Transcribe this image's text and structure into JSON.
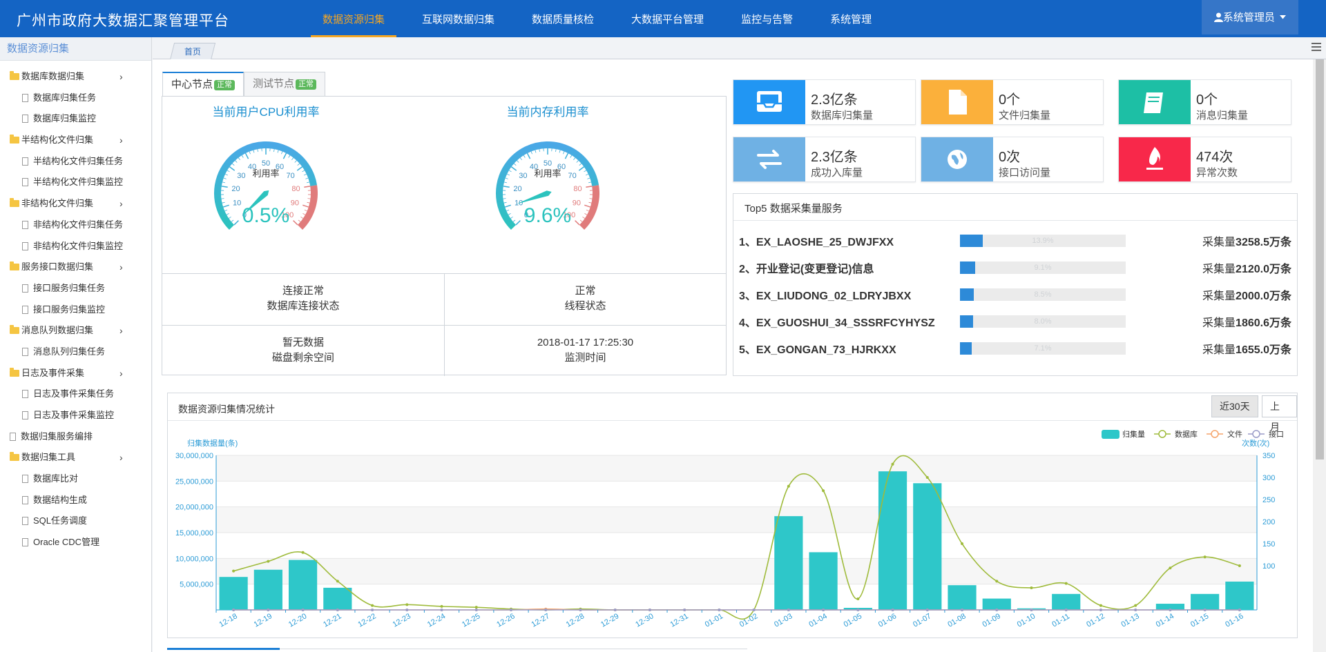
{
  "app": {
    "title": "广州市政府大数据汇聚管理平台",
    "user": "系统管理员"
  },
  "nav": [
    {
      "label": "数据资源归集",
      "active": true
    },
    {
      "label": "互联网数据归集"
    },
    {
      "label": "数据质量核检"
    },
    {
      "label": "大数据平台管理"
    },
    {
      "label": "监控与告警"
    },
    {
      "label": "系统管理"
    }
  ],
  "sidebar": {
    "title": "数据资源归集",
    "items": [
      {
        "label": "数据库数据归集",
        "group": true
      },
      {
        "label": "数据库归集任务"
      },
      {
        "label": "数据库归集监控"
      },
      {
        "label": "半结构化文件归集",
        "group": true
      },
      {
        "label": "半结构化文件归集任务"
      },
      {
        "label": "半结构化文件归集监控"
      },
      {
        "label": "非结构化文件归集",
        "group": true
      },
      {
        "label": "非结构化文件归集任务"
      },
      {
        "label": "非结构化文件归集监控"
      },
      {
        "label": "服务接口数据归集",
        "group": true
      },
      {
        "label": "接口服务归集任务"
      },
      {
        "label": "接口服务归集监控"
      },
      {
        "label": "消息队列数据归集",
        "group": true
      },
      {
        "label": "消息队列归集任务"
      },
      {
        "label": "日志及事件采集",
        "group": true
      },
      {
        "label": "日志及事件采集任务"
      },
      {
        "label": "日志及事件采集监控"
      },
      {
        "label": "数据归集服务编排",
        "doc_root": true
      },
      {
        "label": "数据归集工具",
        "group": true
      },
      {
        "label": "数据库比对"
      },
      {
        "label": "数据结构生成"
      },
      {
        "label": "SQL任务调度"
      },
      {
        "label": "Oracle CDC管理"
      }
    ]
  },
  "page_tab": "首页",
  "node_tabs": [
    {
      "label": "中心节点",
      "badge": "正常",
      "active": true
    },
    {
      "label": "测试节点",
      "badge": "正常"
    }
  ],
  "gauges": [
    {
      "title": "当前用户CPU利用率",
      "label": "利用率",
      "value": 0.5,
      "value_text": "0.5%",
      "ticks": [
        "0",
        "10",
        "20",
        "30",
        "40",
        "50",
        "60",
        "70",
        "80",
        "90",
        "100"
      ]
    },
    {
      "title": "当前内存利用率",
      "label": "利用率",
      "value": 9.6,
      "value_text": "9.6%",
      "ticks": [
        "0",
        "10",
        "20",
        "30",
        "40",
        "50",
        "60",
        "70",
        "80",
        "90",
        "100"
      ]
    }
  ],
  "status": [
    {
      "value": "连接正常",
      "label": "数据库连接状态"
    },
    {
      "value": "正常",
      "label": "线程状态"
    },
    {
      "value": "暂无数据",
      "label": "磁盘剩余空间"
    },
    {
      "value": "2018-01-17 17:25:30",
      "label": "监测时间"
    }
  ],
  "cards": [
    {
      "value": "2.3亿条",
      "label": "数据库归集量",
      "color": "#2196f3",
      "icon": "inbox-icon"
    },
    {
      "value": "0个",
      "label": "文件归集量",
      "color": "#fbb03b",
      "icon": "file-icon"
    },
    {
      "value": "0个",
      "label": "消息归集量",
      "color": "#1dbfa5",
      "icon": "book-icon"
    },
    {
      "value": "2.3亿条",
      "label": "成功入库量",
      "color": "#6fb1e4",
      "icon": "exchange-icon"
    },
    {
      "value": "0次",
      "label": "接口访问量",
      "color": "#6fb1e4",
      "icon": "globe-icon"
    },
    {
      "value": "474次",
      "label": "异常次数",
      "color": "#f8284a",
      "icon": "fire-icon"
    }
  ],
  "top5": {
    "title": "Top5 数据采集量服务",
    "amount_prefix": "采集量",
    "rows": [
      {
        "name": "1、EX_LAOSHE_25_DWJFXX",
        "pct": 13.9,
        "pct_text": "13.9%",
        "amount": "3258.5万条"
      },
      {
        "name": "2、开业登记(变更登记)信息",
        "pct": 9.1,
        "pct_text": "9.1%",
        "amount": "2120.0万条"
      },
      {
        "name": "3、EX_LIUDONG_02_LDRYJBXX",
        "pct": 8.5,
        "pct_text": "8.5%",
        "amount": "2000.0万条"
      },
      {
        "name": "4、EX_GUOSHUI_34_SSSRFCYHYSZ",
        "pct": 8.0,
        "pct_text": "8.0%",
        "amount": "1860.6万条"
      },
      {
        "name": "5、EX_GONGAN_73_HJRKXX",
        "pct": 7.1,
        "pct_text": "7.1%",
        "amount": "1655.0万条"
      }
    ]
  },
  "stats_panel": {
    "title": "数据资源归集情况统计",
    "buttons": [
      {
        "label": "近30天",
        "active": true
      },
      {
        "label": "上月"
      }
    ]
  },
  "chart_data": {
    "type": "bar",
    "categories": [
      "12-18",
      "12-19",
      "12-20",
      "12-21",
      "12-22",
      "12-23",
      "12-24",
      "12-25",
      "12-26",
      "12-27",
      "12-28",
      "12-29",
      "12-30",
      "12-31",
      "01-01",
      "01-02",
      "01-03",
      "01-04",
      "01-05",
      "01-06",
      "01-07",
      "01-08",
      "01-09",
      "01-10",
      "01-11",
      "01-12",
      "01-13",
      "01-14",
      "01-15",
      "01-16"
    ],
    "series": [
      {
        "name": "归集量",
        "type": "bar",
        "axis": "left",
        "color": "#2ec7c9",
        "values": [
          6400000,
          7800000,
          9700000,
          4300000,
          0,
          0,
          0,
          0,
          0,
          0,
          0,
          0,
          0,
          0,
          0,
          0,
          18200000,
          11200000,
          400000,
          26900000,
          24600000,
          4800000,
          2200000,
          300000,
          3100000,
          0,
          0,
          1200000,
          3100000,
          5500000
        ]
      },
      {
        "name": "数据库",
        "type": "line",
        "axis": "right",
        "color": "#9fbb3b",
        "values": [
          88,
          110,
          130,
          65,
          10,
          12,
          8,
          6,
          2,
          0,
          2,
          0,
          0,
          0,
          0,
          0,
          280,
          270,
          25,
          330,
          300,
          150,
          65,
          50,
          60,
          10,
          10,
          95,
          120,
          100
        ]
      },
      {
        "name": "文件",
        "type": "line",
        "axis": "right",
        "color": "#f5a46a",
        "values": [
          0,
          0,
          0,
          0,
          0,
          0,
          0,
          0,
          0,
          2,
          0,
          0,
          0,
          0,
          0,
          0,
          0,
          0,
          0,
          0,
          0,
          0,
          0,
          0,
          0,
          0,
          0,
          0,
          0,
          0
        ]
      },
      {
        "name": "接口",
        "type": "line",
        "axis": "right",
        "color": "#9a9cc8",
        "values": [
          0,
          0,
          0,
          0,
          0,
          0,
          0,
          0,
          0,
          0,
          0,
          0,
          0,
          0,
          0,
          0,
          0,
          0,
          0,
          0,
          0,
          0,
          0,
          0,
          0,
          0,
          0,
          0,
          0,
          0
        ]
      }
    ],
    "ylabel": "归集数据量(条)",
    "y2label": "次数(次)",
    "ylim": [
      0,
      30000000
    ],
    "y2lim": [
      0,
      350
    ],
    "yticks": [
      "5,000,000",
      "10,000,000",
      "15,000,000",
      "20,000,000",
      "25,000,000",
      "30,000,000"
    ],
    "y2ticks": [
      "100",
      "150",
      "200",
      "250",
      "300",
      "350"
    ],
    "legend": "top-right",
    "grid": true
  }
}
